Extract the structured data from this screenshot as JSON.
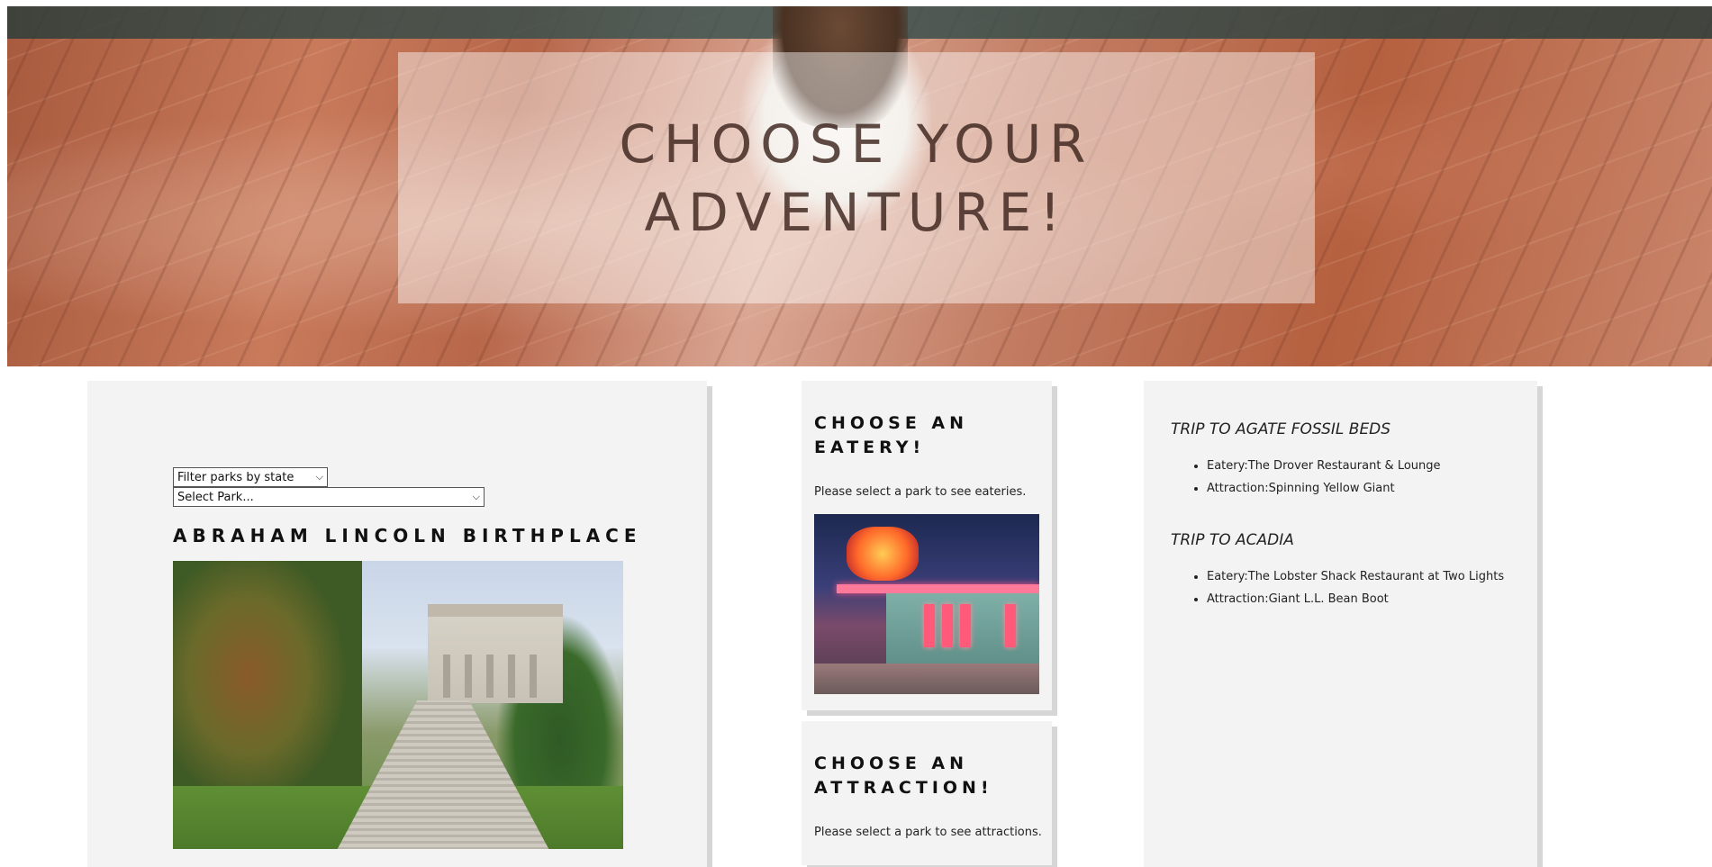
{
  "hero": {
    "title": "CHOOSE YOUR ADVENTURE!"
  },
  "filters": {
    "state_filter": "Filter parks by state",
    "park_select": "Select Park..."
  },
  "park": {
    "name": "ABRAHAM LINCOLN BIRTHPLACE"
  },
  "eatery": {
    "heading": "CHOOSE AN EATERY!",
    "note": "Please select a park to see eateries."
  },
  "attraction": {
    "heading": "CHOOSE AN ATTRACTION!",
    "note": "Please select a park to see attractions."
  },
  "trips": [
    {
      "title": "TRIP TO AGATE FOSSIL BEDS",
      "items": [
        "Eatery:The Drover Restaurant & Lounge",
        "Attraction:Spinning Yellow Giant"
      ]
    },
    {
      "title": "TRIP TO ACADIA",
      "items": [
        "Eatery:The Lobster Shack Restaurant at Two Lights",
        "Attraction:Giant L.L. Bean Boot"
      ]
    }
  ],
  "icons": {
    "select_arrow": "chevron-down-icon"
  },
  "colors": {
    "card_background": "#f3f3f3",
    "card_shadow": "#d6d6d6",
    "hero_title": "#3c231c"
  }
}
